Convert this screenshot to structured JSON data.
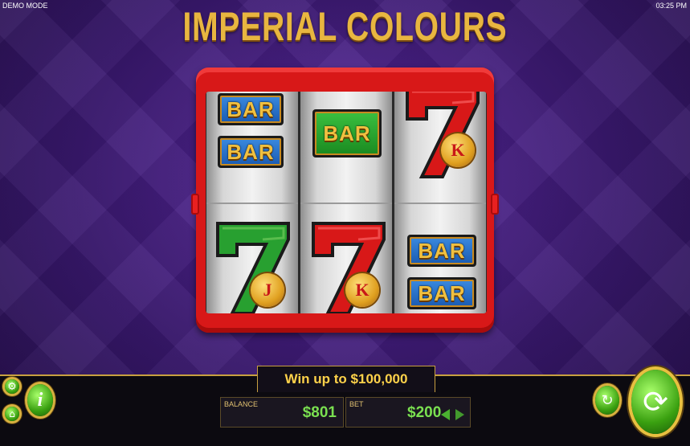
{
  "status_bar": {
    "mode": "DEMO MODE",
    "time": "03:25 PM"
  },
  "game": {
    "title": "IMPERIAL COLOURS"
  },
  "reels": {
    "reel1": {
      "top_bar_upper": "BAR",
      "top_bar_lower": "BAR",
      "bottom_coin": "J"
    },
    "reel2": {
      "top_bar": "BAR",
      "bottom_coin": "K"
    },
    "reel3": {
      "top_coin": "K",
      "bottom_bar_upper": "BAR",
      "bottom_bar_lower": "BAR"
    }
  },
  "panel": {
    "win_text": "Win up to $100,000",
    "balance_label": "BALANCE",
    "balance_value": "$801",
    "bet_label": "BET",
    "bet_value": "$200"
  },
  "icons": {
    "settings": "gear-icon",
    "home": "home-icon",
    "info": "info-icon",
    "autoplay": "autoplay-icon",
    "spin": "spin-icon"
  },
  "colors": {
    "accent_gold": "#e8b640",
    "machine_red": "#d81818",
    "value_green": "#7ae050",
    "button_green": "#3aa010"
  }
}
